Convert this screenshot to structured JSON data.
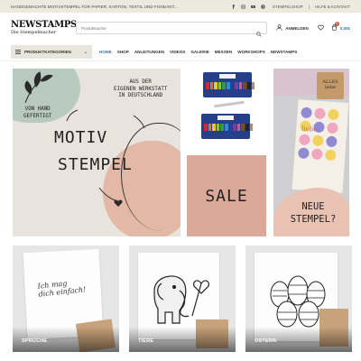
{
  "topbar": {
    "promo": "HANDGEMACHTE MOTIVSTEMPEL FÜR PAPIER, KARTON, TEXTIL UND FONDANT...",
    "links": [
      "STEMPELSHOP",
      "HILFE & KONTAKT"
    ],
    "social_icons": [
      "facebook-icon",
      "instagram-icon",
      "youtube-icon",
      "pinterest-icon"
    ]
  },
  "header": {
    "logo_title": "NEWSTAMPS",
    "logo_subtitle": "Die Stempelmacher",
    "search_placeholder": "Produktsuche",
    "account_label": "ANMELDEN",
    "cart_count": "0",
    "cart_total": "0,00€"
  },
  "nav": {
    "categories_label": "PRODUKTKATEGORIEN",
    "items": [
      {
        "label": "HOME",
        "active": true
      },
      {
        "label": "SHOP",
        "active": false
      },
      {
        "label": "ANLEITUNGEN",
        "active": false
      },
      {
        "label": "VIDEOS",
        "active": false
      },
      {
        "label": "GALERIE",
        "active": false
      },
      {
        "label": "MESSEN",
        "active": false
      },
      {
        "label": "WORKSHOPS",
        "active": false
      },
      {
        "label": "NEWSTAMPS",
        "active": false
      }
    ]
  },
  "hero": {
    "line1": "MOTIV",
    "line2": "STEMPEL",
    "left_note_1": "VON HAND",
    "left_note_2": "GEFERTIGT",
    "right_note_1": "AUS DER",
    "right_note_2": "EIGENEN WERKSTATT",
    "right_note_3": "IN DEUTSCHLAND"
  },
  "tiles": {
    "sale_label": "SALE",
    "new_line1": "NEUE",
    "new_line2": "STEMPEL?",
    "stamp_word_1": "ALLES",
    "stamp_word_2": "liebe",
    "card_word": "liebe"
  },
  "categories": [
    {
      "label": "SPRÜCHE",
      "script_1": "Ich mag",
      "script_2": "dich einfach!"
    },
    {
      "label": "TIERE"
    },
    {
      "label": "OSTERN"
    }
  ],
  "colors": {
    "accent": "#3a7a9a",
    "topbar_bg": "#eceadf",
    "sale_bg": "#dba999",
    "hero_bg": "#e8e3dc"
  }
}
